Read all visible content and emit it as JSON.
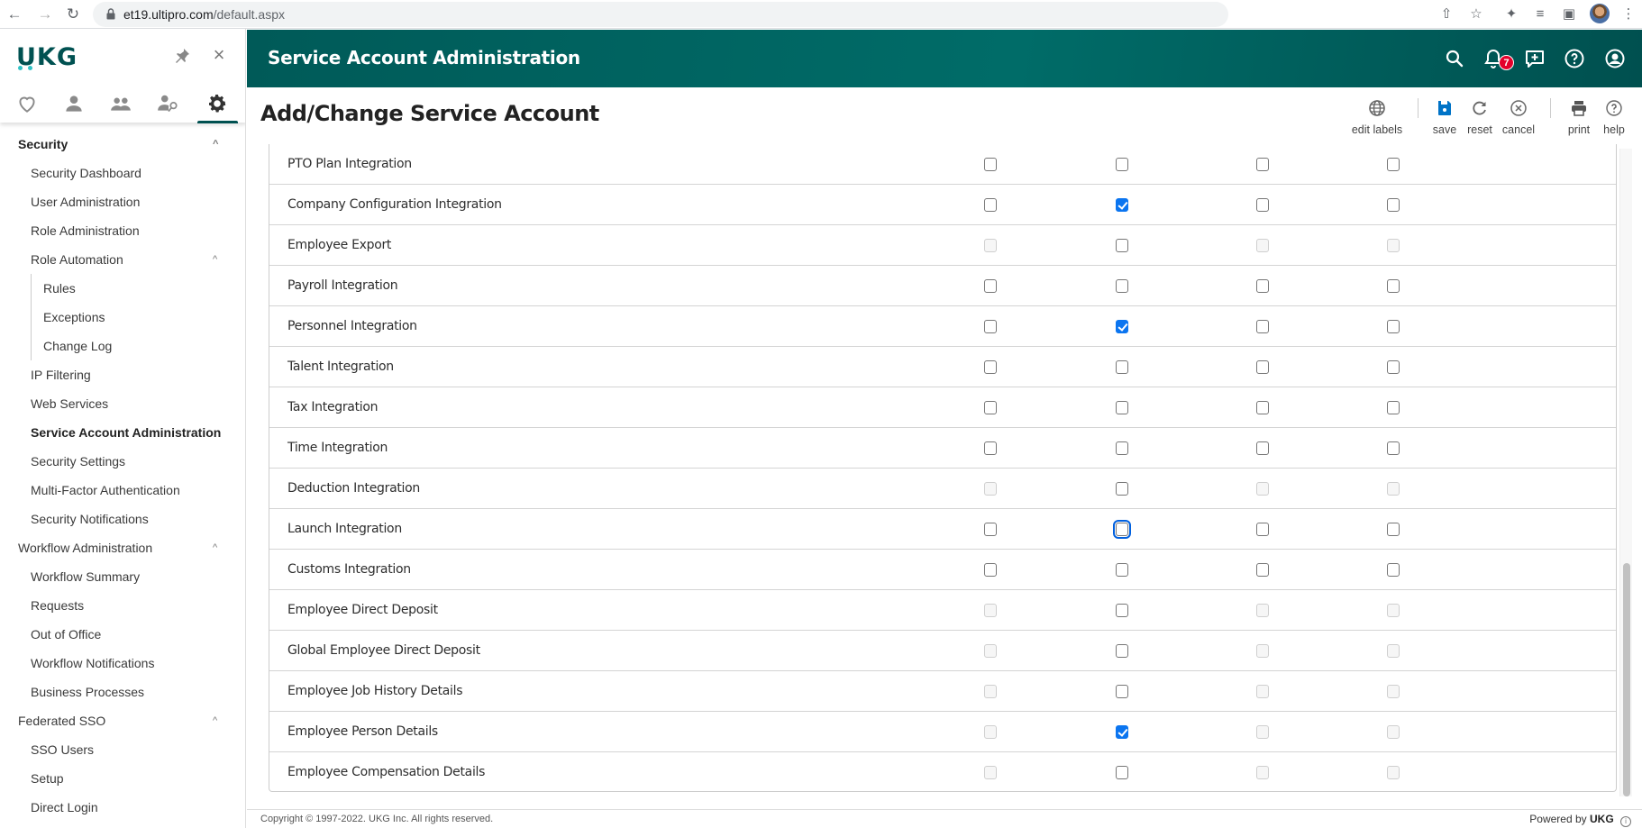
{
  "browser": {
    "url_host": "et19.ultipro.com",
    "url_path": "/default.aspx"
  },
  "sidebar": {
    "logo": "UKG",
    "tabs": [
      {
        "name": "favorites",
        "icon": "heart-icon"
      },
      {
        "name": "myself",
        "icon": "person-icon"
      },
      {
        "name": "team",
        "icon": "people-icon"
      },
      {
        "name": "admin-access",
        "icon": "person-key-icon"
      },
      {
        "name": "system-configuration",
        "icon": "gear-icon",
        "active": true
      }
    ],
    "menu": [
      {
        "label": "Security",
        "level": "section",
        "bold": true,
        "chevron": true
      },
      {
        "label": "Security Dashboard",
        "level": "l1"
      },
      {
        "label": "User Administration",
        "level": "l1"
      },
      {
        "label": "Role Administration",
        "level": "l1"
      },
      {
        "label": "Role Automation",
        "level": "l1",
        "chevron": true
      },
      {
        "label": "Rules",
        "level": "l2"
      },
      {
        "label": "Exceptions",
        "level": "l2"
      },
      {
        "label": "Change Log",
        "level": "l2"
      },
      {
        "label": "IP Filtering",
        "level": "l1"
      },
      {
        "label": "Web Services",
        "level": "l1"
      },
      {
        "label": "Service Account Administration",
        "level": "l1",
        "selected": true
      },
      {
        "label": "Security Settings",
        "level": "l1"
      },
      {
        "label": "Multi-Factor Authentication",
        "level": "l1"
      },
      {
        "label": "Security Notifications",
        "level": "l1"
      },
      {
        "label": "Workflow Administration",
        "level": "section",
        "chevron": true
      },
      {
        "label": "Workflow Summary",
        "level": "l1"
      },
      {
        "label": "Requests",
        "level": "l1"
      },
      {
        "label": "Out of Office",
        "level": "l1"
      },
      {
        "label": "Workflow Notifications",
        "level": "l1"
      },
      {
        "label": "Business Processes",
        "level": "l1"
      },
      {
        "label": "Federated SSO",
        "level": "section",
        "chevron": true
      },
      {
        "label": "SSO Users",
        "level": "l1"
      },
      {
        "label": "Setup",
        "level": "l1"
      },
      {
        "label": "Direct Login",
        "level": "l1"
      }
    ]
  },
  "header": {
    "title": "Service Account Administration",
    "notification_count": "7"
  },
  "page": {
    "title": "Add/Change Service Account"
  },
  "toolbar": {
    "edit_labels": "edit labels",
    "save": "save",
    "reset": "reset",
    "cancel": "cancel",
    "print": "print",
    "help": "help"
  },
  "colors": {
    "brand_teal": "#005151",
    "checkbox_checked": "#0b75f0",
    "badge_red": "#e4002b"
  },
  "permissions": {
    "column_count": 4,
    "rows": [
      {
        "name": "PTO Plan Integration",
        "cells": [
          "off",
          "off",
          "off",
          "off"
        ]
      },
      {
        "name": "Company Configuration Integration",
        "cells": [
          "off",
          "on",
          "off",
          "off"
        ]
      },
      {
        "name": "Employee Export",
        "cells": [
          "disabled",
          "off",
          "disabled",
          "disabled"
        ]
      },
      {
        "name": "Payroll Integration",
        "cells": [
          "off",
          "off",
          "off",
          "off"
        ]
      },
      {
        "name": "Personnel Integration",
        "cells": [
          "off",
          "on",
          "off",
          "off"
        ]
      },
      {
        "name": "Talent Integration",
        "cells": [
          "off",
          "off",
          "off",
          "off"
        ]
      },
      {
        "name": "Tax Integration",
        "cells": [
          "off",
          "off",
          "off",
          "off"
        ]
      },
      {
        "name": "Time Integration",
        "cells": [
          "off",
          "off",
          "off",
          "off"
        ]
      },
      {
        "name": "Deduction Integration",
        "cells": [
          "disabled",
          "off",
          "disabled",
          "disabled"
        ]
      },
      {
        "name": "Launch Integration",
        "cells": [
          "off",
          "focused",
          "off",
          "off"
        ]
      },
      {
        "name": "Customs Integration",
        "cells": [
          "off",
          "off",
          "off",
          "off"
        ]
      },
      {
        "name": "Employee Direct Deposit",
        "cells": [
          "disabled",
          "off",
          "disabled",
          "disabled"
        ]
      },
      {
        "name": "Global Employee Direct Deposit",
        "cells": [
          "disabled",
          "off",
          "disabled",
          "disabled"
        ]
      },
      {
        "name": "Employee Job History Details",
        "cells": [
          "disabled",
          "off",
          "disabled",
          "disabled"
        ]
      },
      {
        "name": "Employee Person Details",
        "cells": [
          "disabled",
          "on",
          "disabled",
          "disabled"
        ]
      },
      {
        "name": "Employee Compensation Details",
        "cells": [
          "disabled",
          "off",
          "disabled",
          "disabled"
        ]
      }
    ]
  },
  "scroll": {
    "thumb_start_fraction": 0.64,
    "thumb_size_fraction": 0.36
  },
  "footer": {
    "copyright": "Copyright © 1997-2022. UKG Inc. All rights reserved.",
    "powered_prefix": "Powered by",
    "powered_brand": "UKG"
  }
}
